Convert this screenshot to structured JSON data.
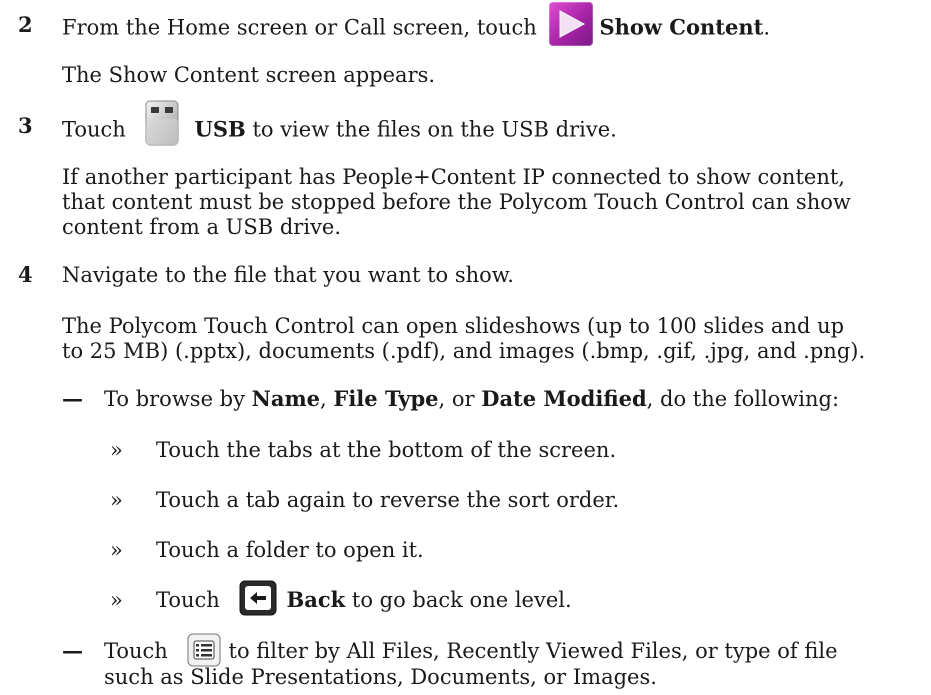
{
  "steps": [
    {
      "number": "2",
      "line1": {
        "before": "From the Home screen or Call screen, touch",
        "icon": "show-content-icon",
        "bold": "Show Content",
        "after": "."
      },
      "line2": "The Show Content screen appears."
    },
    {
      "number": "3",
      "line1": {
        "before": "Touch",
        "icon": "usb-icon",
        "bold": "USB",
        "after": " to view the files on the USB drive."
      },
      "para": [
        "If another participant has People+Content IP connected to show content,",
        "that content must be stopped before the Polycom Touch Control can show",
        "content from a USB drive."
      ]
    },
    {
      "number": "4",
      "line1": "Navigate to the file that you want to show.",
      "para": [
        "The Polycom Touch Control can open slideshows (up to 100 slides and up",
        "to 25 MB) (.pptx), documents (.pdf), and images (.bmp, .gif, .jpg, and .png)."
      ]
    }
  ],
  "bullets": {
    "dash_symbol": "—",
    "sub_symbol": "»",
    "browse": {
      "prefix": "To browse by ",
      "name": "Name",
      "sep1": ", ",
      "file_type": "File Type",
      "sep2": ", or ",
      "date_modified": "Date Modified",
      "suffix": ", do the following:"
    },
    "sub_items": [
      "Touch the tabs at the bottom of the screen.",
      "Touch a tab again to reverse the sort order.",
      "Touch a folder to open it."
    ],
    "back_item": {
      "before": "Touch",
      "icon": "back-icon",
      "bold": "Back",
      "after": " to go back one level."
    },
    "filter": {
      "before": "Touch",
      "icon": "filter-icon",
      "after": "to filter by All Files, Recently Viewed Files, or type of file",
      "line2": "such as Slide Presentations, Documents, or Images."
    }
  }
}
